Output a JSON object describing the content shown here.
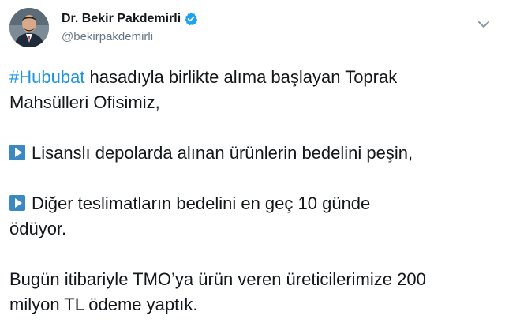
{
  "author": {
    "display_name": "Dr. Bekir Pakdemirli",
    "handle": "@bekirpakdemirli",
    "verified": true
  },
  "tweet": {
    "hashtag": "#Hububat",
    "line1_rest": " hasadıyla birlikte alıma başlayan Toprak",
    "line2": "Mahsülleri Ofisimiz,",
    "item1": "Lisanslı depolarda alınan ürünlerin bedelini peşin,",
    "item2_line1": "Diğer teslimatların bedelini en geç 10 günde",
    "item2_line2": "ödüyor.",
    "para3_line1": "Bugün itibariyle TMO’ya ürün veren üreticilerimize 200",
    "para3_line2": "milyon TL ödeme yaptık."
  },
  "icons": {
    "verified": "verified-badge-icon",
    "menu": "chevron-down-icon",
    "bullet": "play-button-icon"
  },
  "colors": {
    "link": "#1b95e0",
    "verified": "#1da1f2",
    "bullet": "#3b88c3",
    "secondary_text": "#657786"
  }
}
